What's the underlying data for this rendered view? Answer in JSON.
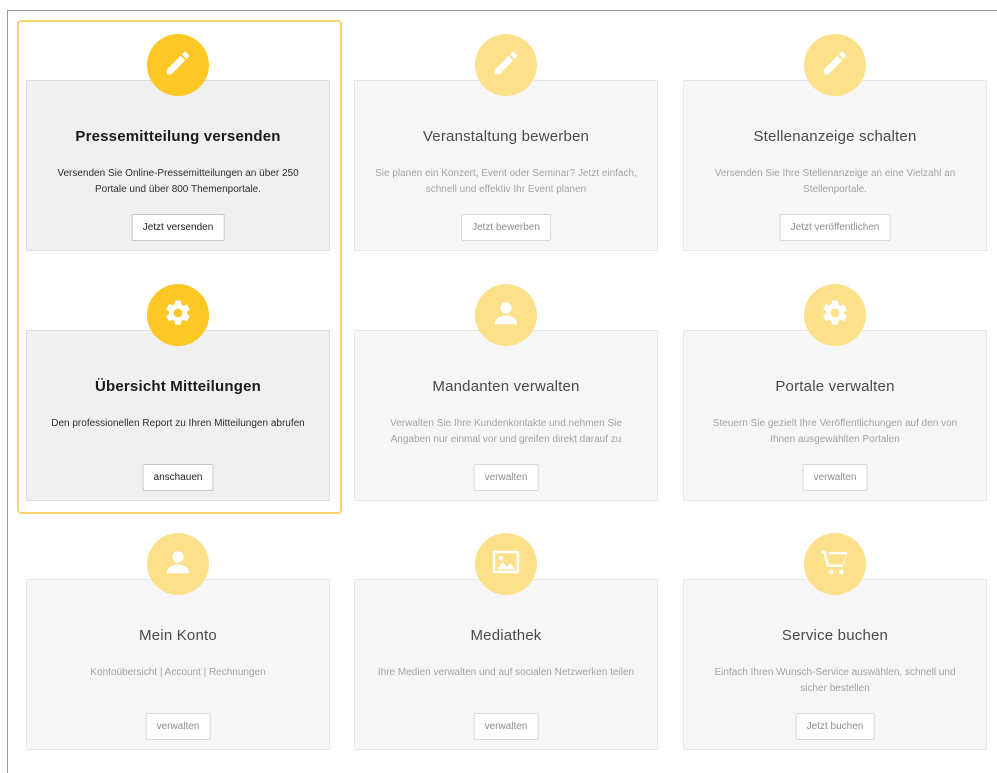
{
  "colors": {
    "accent_active": "#fdc725",
    "accent_inactive": "#fde08a",
    "highlight_border": "#fdd36b"
  },
  "tiles": [
    {
      "icon": "pencil-icon",
      "title": "Pressemitteilung versenden",
      "description": "Versenden Sie Online-Pressemitteilungen an über 250 Portale und über 800 Themenportale.",
      "button": "Jetzt versenden",
      "active": true
    },
    {
      "icon": "pencil-icon",
      "title": "Veranstaltung bewerben",
      "description": "Sie planen ein Konzert, Event oder Seminar? Jetzt einfach, schnell und effektiv Ihr Event planen",
      "button": "Jetzt bewerben",
      "active": false
    },
    {
      "icon": "pencil-icon",
      "title": "Stellenanzeige schalten",
      "description": "Versenden Sie Ihre Stellenanzeige an eine Vielzahl an Stellenportale.",
      "button": "Jetzt veröffentlichen",
      "active": false
    },
    {
      "icon": "gear-icon",
      "title": "Übersicht Mitteilungen",
      "description": "Den professionellen Report zu Ihren Mitteilungen abrufen",
      "button": "anschauen",
      "active": true
    },
    {
      "icon": "user-icon",
      "title": "Mandanten verwalten",
      "description": "Verwalten Sie Ihre Kundenkontakte und nehmen Sie Angaben nur einmal vor und greifen direkt darauf zu",
      "button": "verwalten",
      "active": false
    },
    {
      "icon": "gear-icon",
      "title": "Portale verwalten",
      "description": "Steuern Sie gezielt Ihre Veröffentlichungen auf den von Ihnen ausgewählten Portalen",
      "button": "verwalten",
      "active": false
    },
    {
      "icon": "user-icon",
      "title": "Mein Konto",
      "description": "Kontoübersicht | Account | Rechnungen",
      "button": "verwalten",
      "active": false
    },
    {
      "icon": "image-icon",
      "title": "Mediathek",
      "description": "Ihre Medien verwalten und auf socialen Netzwerken teilen",
      "button": "verwalten",
      "active": false
    },
    {
      "icon": "cart-icon",
      "title": "Service buchen",
      "description": "Einfach Ihren Wunsch-Service auswählen, schnell und sicher bestellen",
      "button": "Jetzt buchen",
      "active": false
    }
  ]
}
